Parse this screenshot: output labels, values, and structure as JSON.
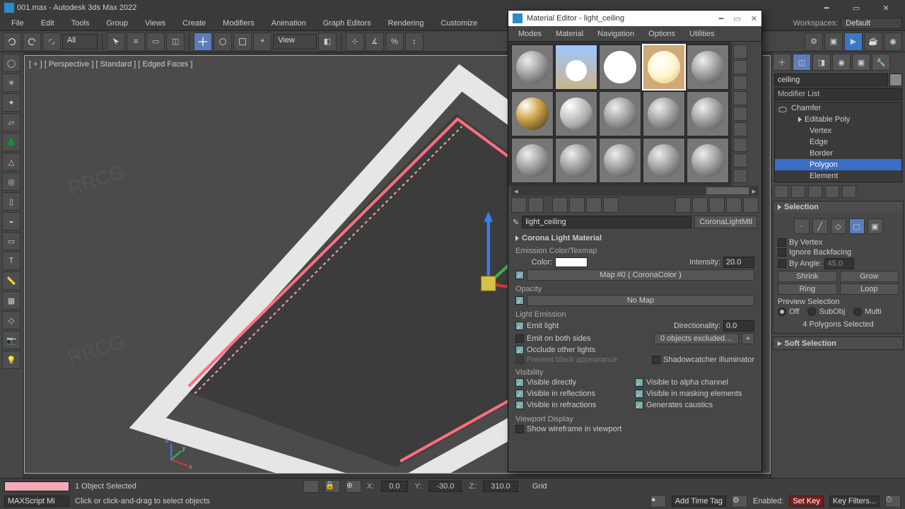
{
  "app": {
    "title": "001.max - Autodesk 3ds Max 2022",
    "workspace_label": "Workspaces:",
    "workspace_value": "Default"
  },
  "menus": [
    "File",
    "Edit",
    "Tools",
    "Group",
    "Views",
    "Create",
    "Modifiers",
    "Animation",
    "Graph Editors",
    "Rendering",
    "Customize"
  ],
  "top_toolbar": {
    "selection_filter": "All",
    "ref_coords": "View"
  },
  "viewport": {
    "label": "[ + ] [ Perspective ] [ Standard ] [ Edged Faces ]",
    "axis_x": "x",
    "axis_y": "y",
    "axis_z": ""
  },
  "mat_editor": {
    "title": "Material Editor - light_ceiling",
    "menus": [
      "Modes",
      "Material",
      "Navigation",
      "Options",
      "Utilities"
    ],
    "material_name": "light_ceiling",
    "material_type": "CoronaLightMtl",
    "rollout": {
      "title": "Corona Light Material",
      "emission_header": "Emission Color/Texmap",
      "color_label": "Color:",
      "intensity_label": "Intensity:",
      "intensity_value": "20.0",
      "map_btn": "Map #0  ( CoronaColor )",
      "opacity_header": "Opacity",
      "opacity_btn": "No Map",
      "light_emission_header": "Light Emission",
      "emit_light": "Emit light",
      "direction_label": "Directionality:",
      "direction_value": "0.0",
      "emit_both": "Emit on both sides",
      "excluded": "0 objects excluded…",
      "occlude": "Occlude other lights",
      "prevent_black": "Prevent black appearance",
      "shadowcatcher": "Shadowcatcher illuminator",
      "visibility_header": "Visibility",
      "visible_directly": "Visible directly",
      "visible_alpha": "Visible to alpha channel",
      "visible_refl": "Visible in reflections",
      "visible_mask": "Visible in masking elements",
      "visible_refr": "Visible in refractions",
      "gen_caustics": "Generates caustics",
      "viewport_header": "Viewport Display",
      "show_wire": "Show wireframe in viewport"
    }
  },
  "cmd_panel": {
    "object_name": "ceiling",
    "modifier_list": "Modifier List",
    "stack": {
      "chamfer": "Chamfer",
      "editable_poly": "Editable Poly",
      "vertex": "Vertex",
      "edge": "Edge",
      "border": "Border",
      "polygon": "Polygon",
      "element": "Element"
    },
    "selection": {
      "title": "Selection",
      "by_vertex": "By Vertex",
      "ignore_backfacing": "Ignore Backfacing",
      "by_angle": "By Angle:",
      "by_angle_value": "45.0",
      "shrink": "Shrink",
      "grow": "Grow",
      "ring": "Ring",
      "loop": "Loop",
      "preview": "Preview Selection",
      "off": "Off",
      "subobj": "SubObj",
      "multi": "Multi",
      "count": "4 Polygons Selected"
    },
    "soft_sel_title": "Soft Selection"
  },
  "status": {
    "objects_selected": "1 Object Selected",
    "maxscript_label": "MAXScript Mi",
    "hint": "Click or click-and-drag to select objects",
    "x_label": "X:",
    "y_label": "Y:",
    "z_label": "Z:",
    "x": "0.0",
    "y": "-30.0",
    "z": "310.0",
    "grid": "Grid",
    "add_time_tag": "Add Time Tag",
    "enabled": "Enabled:",
    "set_key": "Set Key",
    "key_filters": "Key Filters..."
  }
}
